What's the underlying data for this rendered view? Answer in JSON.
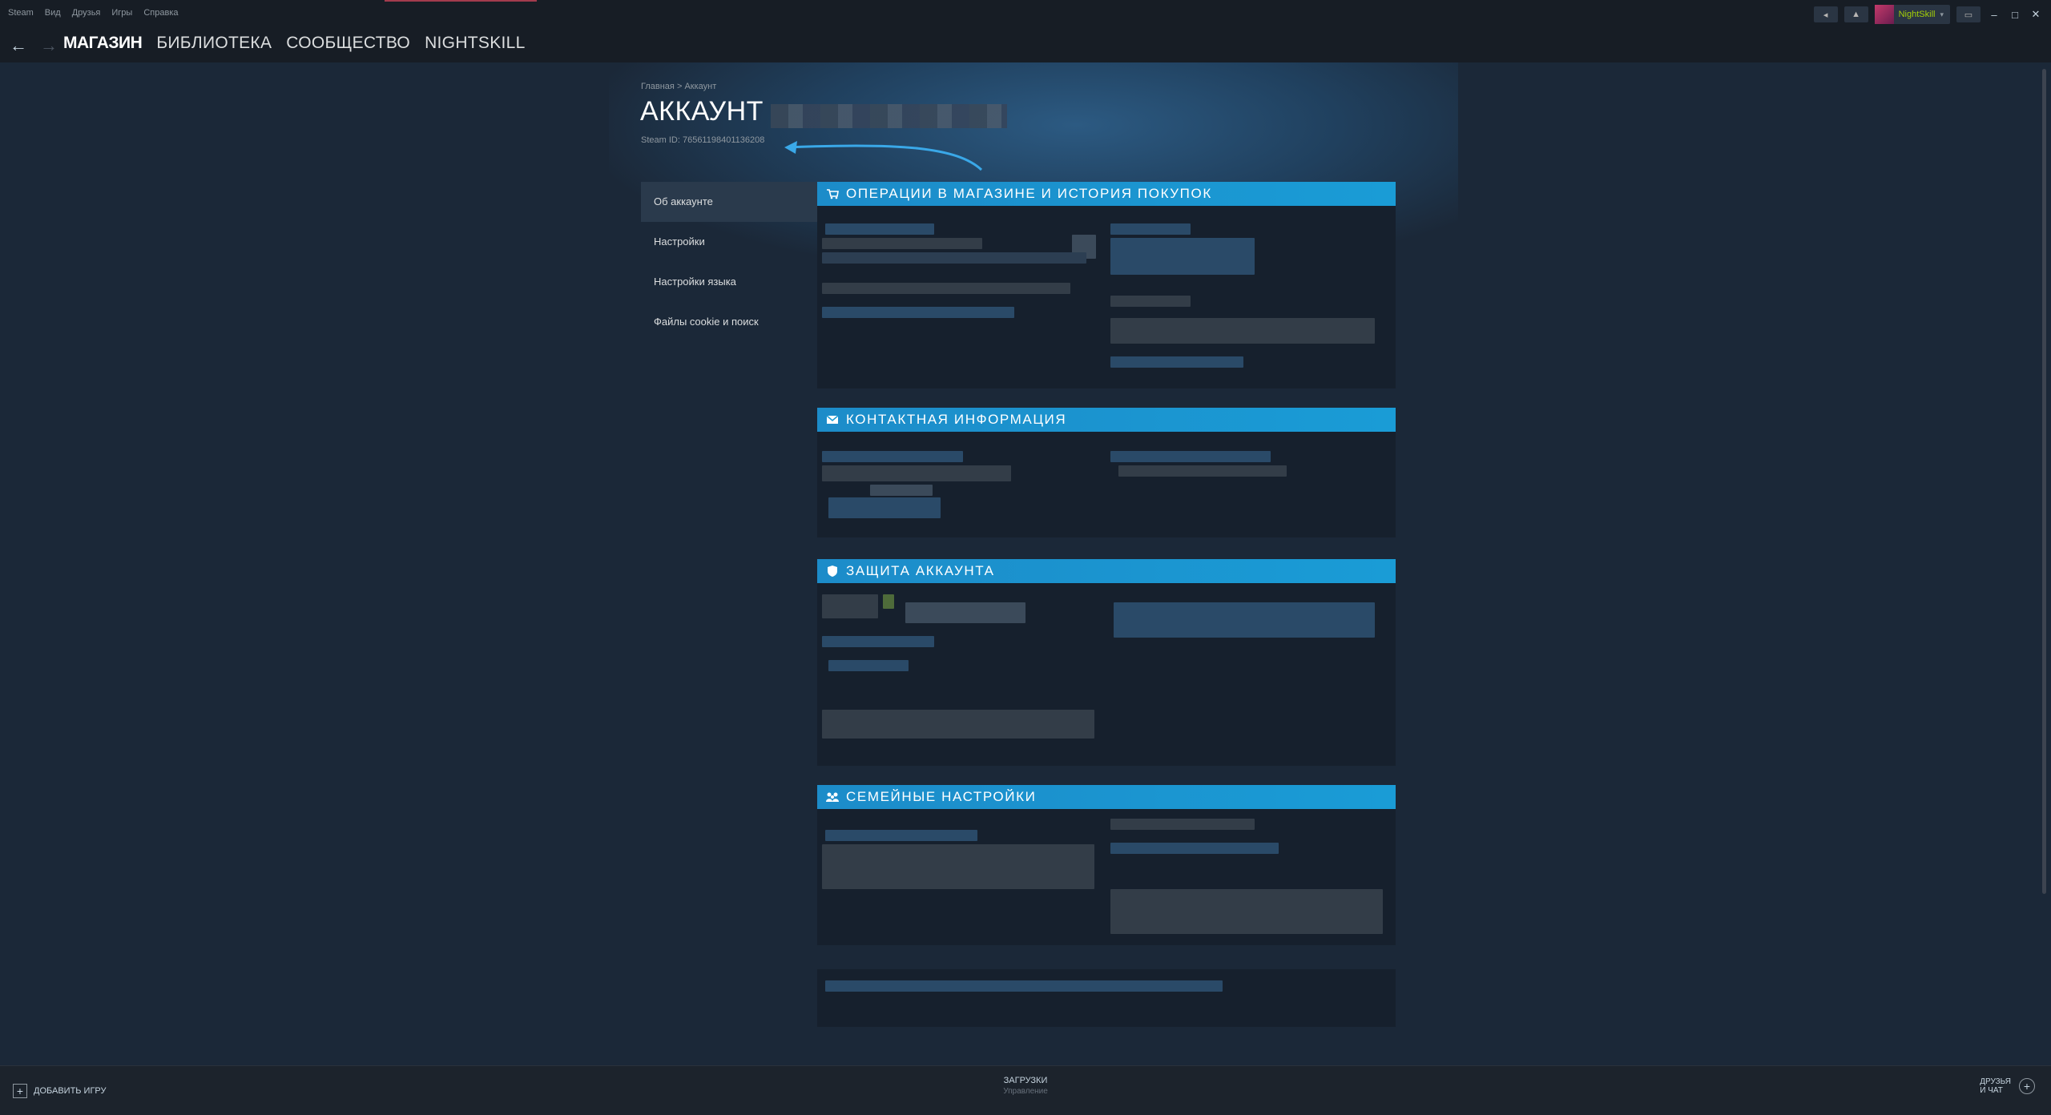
{
  "menubar": {
    "items": [
      "Steam",
      "Вид",
      "Друзья",
      "Игры",
      "Справка"
    ],
    "username": "NightSkill"
  },
  "nav": {
    "links": [
      "МАГАЗИН",
      "БИБЛИОТЕКА",
      "СООБЩЕСТВО",
      "NIGHTSKILL"
    ]
  },
  "page": {
    "breadcrumb_home": "Главная",
    "breadcrumb_sep": ">",
    "breadcrumb_current": "Аккаунт",
    "title": "АККАУНТ",
    "steam_id": "Steam ID: 76561198401136208"
  },
  "leftnav": {
    "items": [
      "Об аккаунте",
      "Настройки",
      "Настройки языка",
      "Файлы cookie и поиск"
    ]
  },
  "panels": {
    "store": "ОПЕРАЦИИ В МАГАЗИНЕ И ИСТОРИЯ ПОКУПОК",
    "contact": "КОНТАКТНАЯ ИНФОРМАЦИЯ",
    "security": "ЗАЩИТА АККАУНТА",
    "family": "СЕМЕЙНЫЕ НАСТРОЙКИ"
  },
  "bottom": {
    "add_game": "ДОБАВИТЬ ИГРУ",
    "downloads": "ЗАГРУЗКИ",
    "downloads_sub": "Управление",
    "friends_line1": "ДРУЗЬЯ",
    "friends_line2": "И ЧАТ"
  },
  "colors": {
    "accent": "#1a9cd6",
    "background": "#1b2838",
    "username": "#a4d007"
  },
  "icons": [
    "back-icon",
    "forward-icon",
    "cart-icon",
    "mail-icon",
    "shield-icon",
    "family-icon",
    "plus-icon"
  ]
}
